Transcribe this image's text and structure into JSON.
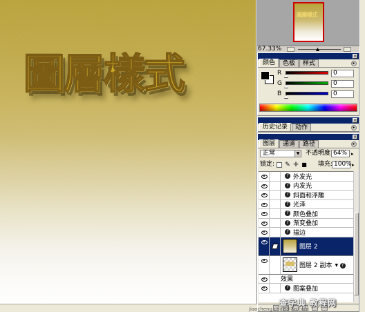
{
  "canvas": {
    "art_text": "圖層樣式"
  },
  "navigator": {
    "thumb_text": "圖層樣式",
    "zoom": "67.33%"
  },
  "color_panel": {
    "tabs": [
      "颜色",
      "色板",
      "样式"
    ],
    "channels": [
      {
        "label": "R",
        "value": "0",
        "color": "#e00000"
      },
      {
        "label": "G",
        "value": "0",
        "color": "#00b000"
      },
      {
        "label": "B",
        "value": "0",
        "color": "#0000d0"
      }
    ]
  },
  "history_panel": {
    "tabs": [
      "历史记录",
      "动作"
    ]
  },
  "layers_panel": {
    "tabs": [
      "图层",
      "通道",
      "路径"
    ],
    "blend_mode": "正常",
    "opacity_label": "不透明度:",
    "opacity": "64%",
    "lock_label": "锁定:",
    "fill_label": "填充:",
    "fill": "100%",
    "effects_top": [
      "外发光",
      "内发光",
      "斜面和浮雕",
      "光泽",
      "颜色叠加",
      "渐变叠加",
      "描边"
    ],
    "layers": [
      {
        "name": "图层 2",
        "selected": true
      },
      {
        "name": "图层 2 副本",
        "selected": false
      }
    ],
    "effects_head": "效果",
    "effects_bottom": [
      "图案叠加"
    ]
  },
  "watermark": {
    "main": "查字典 教程网",
    "sub": "jiaocheng.chazidian.com"
  },
  "colors": {
    "titlebar": "#0a246a",
    "selection": "#0a246a",
    "panel_bg": "#ece9d8"
  }
}
